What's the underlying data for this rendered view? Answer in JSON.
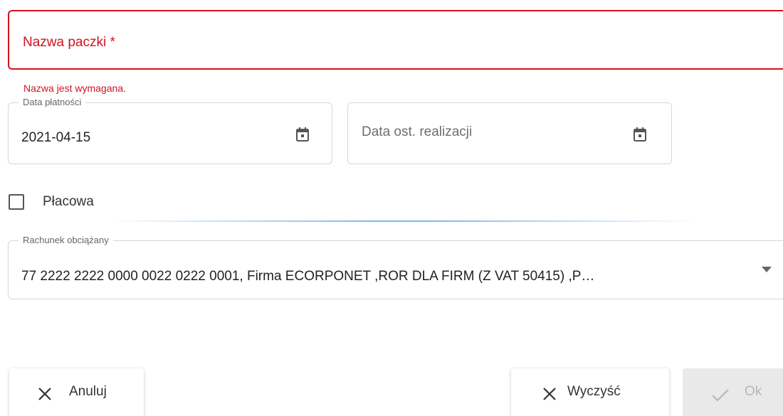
{
  "form": {
    "name_field": {
      "label": "Nazwa paczki *",
      "value": "",
      "error": "Nazwa jest wymagana."
    },
    "payment_date": {
      "label": "Data płatności",
      "value": "2021-04-15",
      "icon": "calendar-icon"
    },
    "last_execution_date": {
      "placeholder": "Data ost. realizacji",
      "value": "",
      "icon": "calendar-icon"
    },
    "payroll_checkbox": {
      "label": "Płacowa",
      "checked": false
    },
    "debit_account": {
      "label": "Rachunek obciążany",
      "value": "77 2222 2222 0000 0022 0222 0001, Firma ECORPONET ,ROR DLA FIRM (Z VAT 50415) ,P…",
      "icon": "dropdown-arrow-icon"
    }
  },
  "actions": {
    "cancel_label": "Anuluj",
    "clear_label": "Wyczyść",
    "ok_label": "Ok"
  },
  "colors": {
    "error": "#d3121f",
    "border": "#d6d6d6",
    "disabled_bg": "#e9e9e9",
    "disabled_text": "#b7b7b7"
  }
}
